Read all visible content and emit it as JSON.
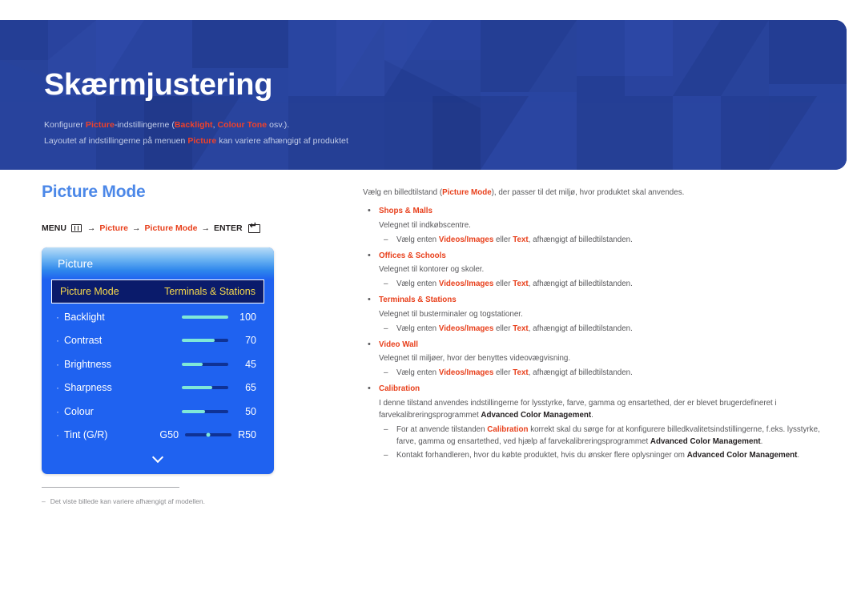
{
  "banner": {
    "title": "Skærmjustering",
    "line1": {
      "pre": "Konfigurer ",
      "hl1": "Picture",
      "mid1": "-indstillingerne (",
      "hl2": "Backlight",
      "mid2": ", ",
      "hl3": "Colour Tone",
      "post": " osv.)."
    },
    "line2": {
      "pre": "Layoutet af indstillingerne på menuen ",
      "hl1": "Picture",
      "post": " kan variere afhængigt af produktet"
    }
  },
  "left": {
    "section_title": "Picture Mode",
    "breadcrumb": {
      "menu_label": "MENU",
      "menu_icon": "menu-grid-icon",
      "arrow": "→",
      "step1": "Picture",
      "step2": "Picture Mode",
      "enter_label": "ENTER",
      "enter_icon": "enter-return-icon"
    },
    "osd": {
      "header_title": "Picture",
      "selected_row": {
        "label": "Picture Mode",
        "value": "Terminals & Stations"
      },
      "rows": [
        {
          "bullet": "·",
          "label": "Backlight",
          "value": "100",
          "fill_pct": 100
        },
        {
          "bullet": "·",
          "label": "Contrast",
          "value": "70",
          "fill_pct": 70
        },
        {
          "bullet": "·",
          "label": "Brightness",
          "value": "45",
          "fill_pct": 45
        },
        {
          "bullet": "·",
          "label": "Sharpness",
          "value": "65",
          "fill_pct": 65
        },
        {
          "bullet": "·",
          "label": "Colour",
          "value": "50",
          "fill_pct": 50
        }
      ],
      "tint_row": {
        "bullet": "·",
        "label": "Tint (G/R)",
        "left_value": "G50",
        "right_value": "R50",
        "knob_pct": 50
      },
      "scroll_icon": "chevron-down-icon"
    },
    "footnote": {
      "dash": "–",
      "text": "Det viste billede kan variere afhængigt af modellen."
    }
  },
  "right": {
    "intro": {
      "pre": "Vælg en billedtilstand (",
      "bold": "Picture Mode",
      "post": "), der passer til det miljø, hvor produktet skal anvendes."
    },
    "bullet_char": "•",
    "dash_char": "–",
    "items": [
      {
        "title": "Shops & Malls",
        "desc": "Velegnet til indkøbscentre.",
        "subs": [
          {
            "pre": "Vælg enten ",
            "b1": "Videos/Images",
            "mid": " eller ",
            "b2": "Text",
            "post": ", afhængigt af billedtilstanden."
          }
        ]
      },
      {
        "title": "Offices & Schools",
        "desc": "Velegnet til kontorer og skoler.",
        "subs": [
          {
            "pre": "Vælg enten ",
            "b1": "Videos/Images",
            "mid": " eller ",
            "b2": "Text",
            "post": ", afhængigt af billedtilstanden."
          }
        ]
      },
      {
        "title": "Terminals & Stations",
        "desc": "Velegnet til busterminaler og togstationer.",
        "subs": [
          {
            "pre": "Vælg enten ",
            "b1": "Videos/Images",
            "mid": " eller ",
            "b2": "Text",
            "post": ", afhængigt af billedtilstanden."
          }
        ]
      },
      {
        "title": "Video Wall",
        "desc": "Velegnet til miljøer, hvor der benyttes videovægvisning.",
        "subs": [
          {
            "pre": "Vælg enten ",
            "b1": "Videos/Images",
            "mid": " eller ",
            "b2": "Text",
            "post": ", afhængigt af billedtilstanden."
          }
        ]
      }
    ],
    "calibration": {
      "title": "Calibration",
      "desc_pre": "I denne tilstand anvendes indstillingerne for lysstyrke, farve, gamma og ensartethed, der er blevet brugerdefineret i farvekalibreringsprogrammet ",
      "desc_bold": "Advanced Color Management",
      "desc_post": ".",
      "subs": [
        {
          "pre": "For at anvende tilstanden ",
          "b1": "Calibration",
          "mid": " korrekt skal du sørge for at konfigurere billedkvalitetsindstillingerne, f.eks. lysstyrke, farve, gamma og ensartethed, ved hjælp af farvekalibreringsprogrammet ",
          "b2": "Advanced Color Management",
          "post": "."
        },
        {
          "pre": "Kontakt forhandleren, hvor du købte produktet, hvis du ønsker flere oplysninger om ",
          "b1": "",
          "mid": "",
          "b2": "Advanced Color Management",
          "post": "."
        }
      ]
    }
  }
}
